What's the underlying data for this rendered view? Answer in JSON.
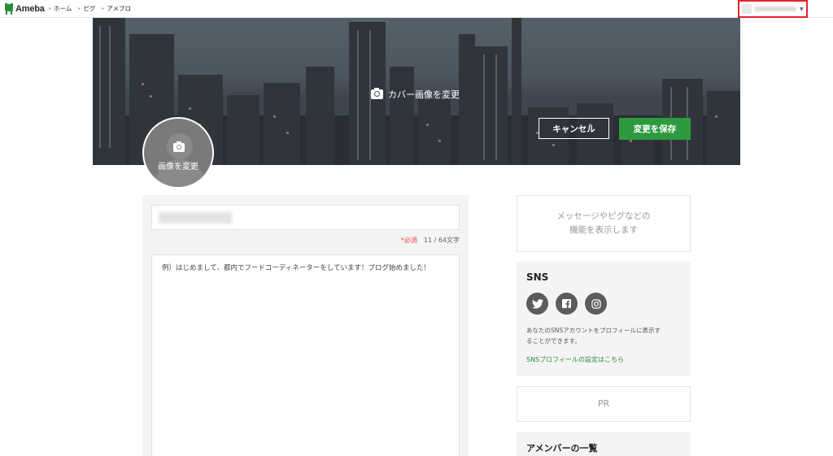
{
  "header": {
    "logo_text": "Ameba",
    "nav": [
      {
        "label": "ホーム"
      },
      {
        "label": "ピグ"
      },
      {
        "label": "アメブロ"
      }
    ]
  },
  "cover": {
    "change_label": "カバー画像を変更",
    "cancel_label": "キャンセル",
    "save_label": "変更を保存"
  },
  "profile": {
    "change_image_label": "画像を変更"
  },
  "form": {
    "required_label": "*必須",
    "char_count": "11 / 64文字",
    "bio_placeholder": "例）はじめまして、都内でフードコーディネーターをしています！ブログ始めました！"
  },
  "sidebar": {
    "message_line1": "メッセージやピグなどの",
    "message_line2": "機能を表示します",
    "sns_title": "SNS",
    "sns_desc_line1": "あなたのSNSアカウントをプロフィールに表示す",
    "sns_desc_line2": "ることができます。",
    "sns_link": "SNSプロフィールの設定はこちら",
    "pr_label": "PR",
    "amember_title": "アメンバーの一覧"
  },
  "colors": {
    "accent_green": "#2d9a3f",
    "highlight_red": "#e8212b"
  }
}
